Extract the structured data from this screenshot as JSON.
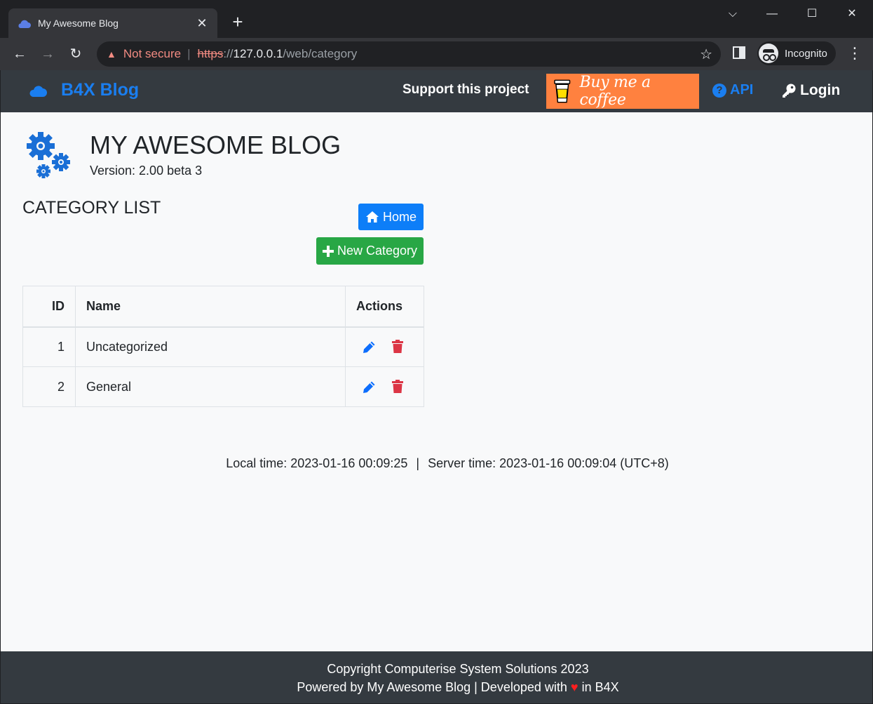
{
  "browser": {
    "tab_title": "My Awesome Blog",
    "security_label": "Not secure",
    "url_scheme": "https",
    "url_separator": "://",
    "url_host": "127.0.0.1",
    "url_path": "/web/category",
    "incognito_label": "Incognito"
  },
  "navbar": {
    "brand": "B4X Blog",
    "support_label": "Support this project",
    "coffee_label": "Buy me a coffee",
    "api_label": "API",
    "login_label": "Login"
  },
  "header": {
    "title": "MY AWESOME BLOG",
    "version": "Version: 2.00 beta 3"
  },
  "category_list": {
    "title": "CATEGORY LIST",
    "home_button": "Home",
    "new_button": "New Category",
    "columns": [
      "ID",
      "Name",
      "Actions"
    ],
    "rows": [
      {
        "id": "1",
        "name": "Uncategorized"
      },
      {
        "id": "2",
        "name": "General"
      }
    ]
  },
  "status": {
    "local_time": "Local time: 2023-01-16 00:09:25",
    "separator": "|",
    "server_time": "Server time: 2023-01-16 00:09:04 (UTC+8)"
  },
  "footer": {
    "copyright": "Copyright Computerise System Solutions 2023",
    "powered_prefix": "Powered by My Awesome Blog | Developed with",
    "heart": "♥",
    "powered_suffix": "in B4X"
  },
  "colors": {
    "navbar_bg": "#343a40",
    "brand_blue": "#1a7ef0",
    "coffee_orange": "#ff813f",
    "home_blue": "#0d7ef8",
    "new_green": "#28a745",
    "delete_red": "#dc3545",
    "page_bg": "#f8f9fa"
  }
}
